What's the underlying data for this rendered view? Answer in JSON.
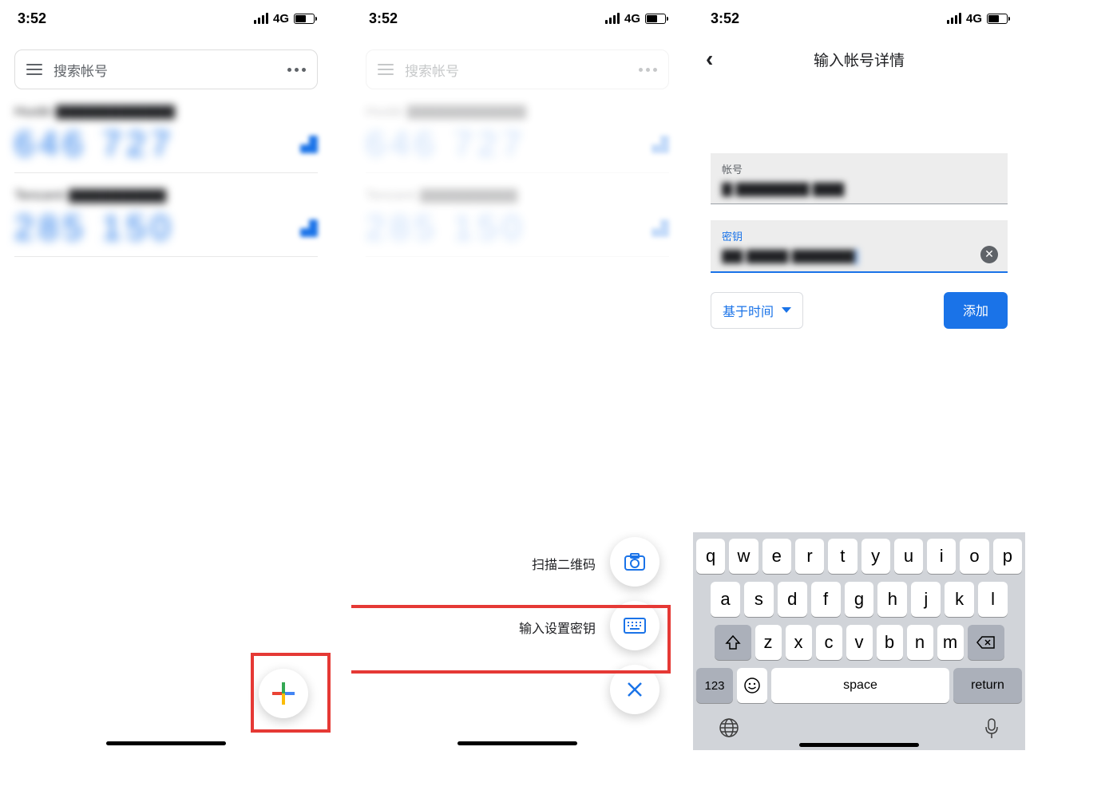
{
  "status": {
    "time": "3:52",
    "net": "4G"
  },
  "screen1": {
    "search_placeholder": "搜索帐号",
    "accounts": [
      {
        "name": "Huobi ▇▇▇▇▇▇▇▇▇▇▇",
        "code": "646 727"
      },
      {
        "name": "Tencent ▇▇▇▇▇▇▇▇▇",
        "code": "285 150"
      }
    ]
  },
  "screen2": {
    "search_placeholder": "搜索帐号",
    "action_scan": "扫描二维码",
    "action_key": "输入设置密钥"
  },
  "screen3": {
    "title": "输入帐号详情",
    "field_account_label": "帐号",
    "field_account_value": "▇ ▇▇▇▇▇▇▇ ▇▇▇",
    "field_key_label": "密钥",
    "field_key_value": "▇▇ ▇▇▇▇ ▇▇▇▇▇▇",
    "dropdown_label": "基于时间",
    "add_button": "添加"
  },
  "keyboard": {
    "row1": [
      "q",
      "w",
      "e",
      "r",
      "t",
      "y",
      "u",
      "i",
      "o",
      "p"
    ],
    "row2": [
      "a",
      "s",
      "d",
      "f",
      "g",
      "h",
      "j",
      "k",
      "l"
    ],
    "row3": [
      "z",
      "x",
      "c",
      "v",
      "b",
      "n",
      "m"
    ],
    "shift": "⇧",
    "backspace": "⌫",
    "numbers": "123",
    "emoji": "☺",
    "space": "space",
    "return": "return",
    "globe": "🌐",
    "mic": "🎤"
  }
}
